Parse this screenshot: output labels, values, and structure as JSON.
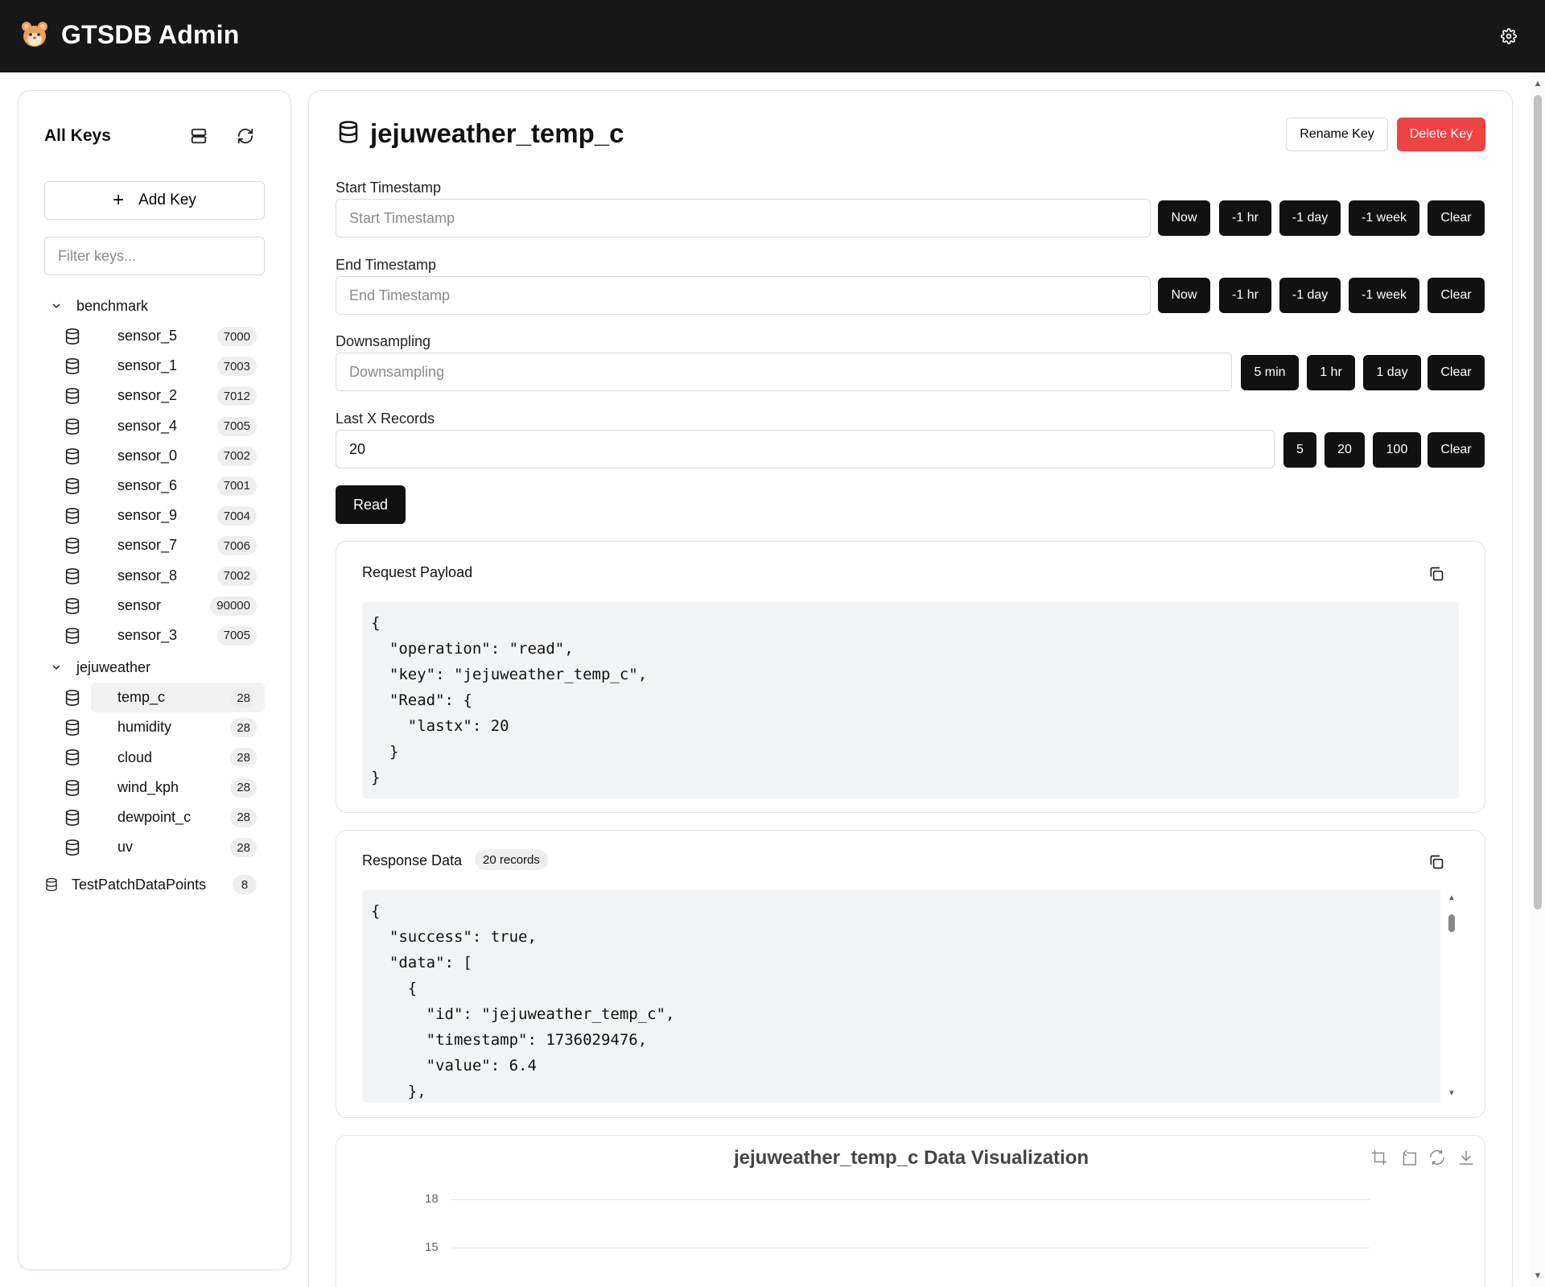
{
  "header": {
    "title": "GTSDB Admin",
    "logo_icon": "hamster-icon",
    "settings_icon": "gear-icon"
  },
  "sidebar": {
    "title": "All Keys",
    "add_key_label": "Add Key",
    "filter_placeholder": "Filter keys...",
    "groups": [
      {
        "name": "benchmark",
        "keys": [
          {
            "name": "sensor_5",
            "count": "7000"
          },
          {
            "name": "sensor_1",
            "count": "7003"
          },
          {
            "name": "sensor_2",
            "count": "7012"
          },
          {
            "name": "sensor_4",
            "count": "7005"
          },
          {
            "name": "sensor_0",
            "count": "7002"
          },
          {
            "name": "sensor_6",
            "count": "7001"
          },
          {
            "name": "sensor_9",
            "count": "7004"
          },
          {
            "name": "sensor_7",
            "count": "7006"
          },
          {
            "name": "sensor_8",
            "count": "7002"
          },
          {
            "name": "sensor",
            "count": "90000"
          },
          {
            "name": "sensor_3",
            "count": "7005"
          }
        ]
      },
      {
        "name": "jejuweather",
        "keys": [
          {
            "name": "temp_c",
            "count": "28",
            "active": true
          },
          {
            "name": "humidity",
            "count": "28"
          },
          {
            "name": "cloud",
            "count": "28"
          },
          {
            "name": "wind_kph",
            "count": "28"
          },
          {
            "name": "dewpoint_c",
            "count": "28"
          },
          {
            "name": "uv",
            "count": "28"
          }
        ]
      }
    ],
    "solo_keys": [
      {
        "name": "TestPatchDataPoints",
        "count": "8"
      }
    ]
  },
  "main": {
    "key_title": "jejuweather_temp_c",
    "rename_label": "Rename Key",
    "delete_label": "Delete Key",
    "start": {
      "label": "Start Timestamp",
      "placeholder": "Start Timestamp",
      "value": "",
      "buttons": [
        "Now",
        "-1 hr",
        "-1 day",
        "-1 week",
        "Clear"
      ]
    },
    "end": {
      "label": "End Timestamp",
      "placeholder": "End Timestamp",
      "value": "",
      "buttons": [
        "Now",
        "-1 hr",
        "-1 day",
        "-1 week",
        "Clear"
      ]
    },
    "downsampling": {
      "label": "Downsampling",
      "placeholder": "Downsampling",
      "value": "",
      "buttons": [
        "5 min",
        "1 hr",
        "1 day",
        "Clear"
      ]
    },
    "lastx": {
      "label": "Last X Records",
      "placeholder": "",
      "value": "20",
      "buttons": [
        "5",
        "20",
        "100",
        "Clear"
      ]
    },
    "read_label": "Read",
    "request": {
      "title": "Request Payload",
      "code": "{\n  \"operation\": \"read\",\n  \"key\": \"jejuweather_temp_c\",\n  \"Read\": {\n    \"lastx\": 20\n  }\n}"
    },
    "response": {
      "title": "Response Data",
      "records_badge": "20 records",
      "code": "{\n  \"success\": true,\n  \"data\": [\n    {\n      \"id\": \"jejuweather_temp_c\",\n      \"timestamp\": 1736029476,\n      \"value\": 6.4\n    },"
    },
    "chart": {
      "title": "jejuweather_temp_c Data Visualization",
      "tools": [
        "zoom-select-icon",
        "zoom-reset-icon",
        "restore-icon",
        "download-icon"
      ]
    }
  },
  "chart_data": {
    "type": "line",
    "title": "jejuweather_temp_c Data Visualization",
    "y_ticks": [
      "18",
      "15"
    ],
    "series": []
  }
}
